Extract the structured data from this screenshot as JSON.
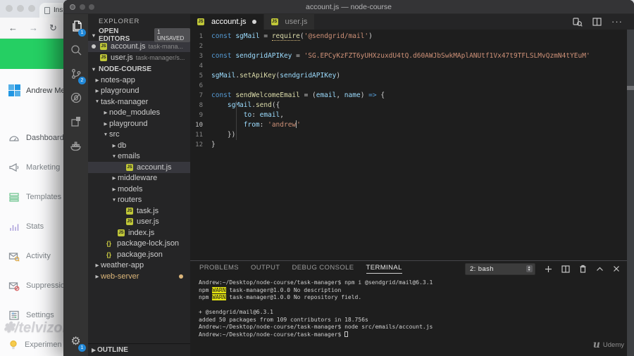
{
  "window": {
    "title": "account.js — node-course"
  },
  "browser": {
    "tab_label": "Ins",
    "banner_color": "#25cf63",
    "nav_icons": [
      "back-icon",
      "forward-icon",
      "reload-icon",
      "lock-icon"
    ],
    "sidebar": {
      "account_name": "Andrew Mead",
      "items": [
        {
          "label": "Dashboard",
          "icon": "gauge-icon"
        },
        {
          "label": "Marketing",
          "icon": "megaphone-icon"
        },
        {
          "label": "Templates",
          "icon": "templates-icon"
        },
        {
          "label": "Stats",
          "icon": "stats-icon"
        },
        {
          "label": "Activity",
          "icon": "activity-icon"
        },
        {
          "label": "Suppressions",
          "icon": "suppressions-icon"
        },
        {
          "label": "Settings",
          "icon": "settings-icon"
        },
        {
          "label": "Experimen",
          "icon": "bulb-icon"
        }
      ]
    },
    "watermark": "/telvizon"
  },
  "activity_bar": {
    "items": [
      {
        "icon": "files-icon",
        "badge": "1",
        "active": true
      },
      {
        "icon": "search-icon"
      },
      {
        "icon": "source-control-icon",
        "badge": "2"
      },
      {
        "icon": "debug-icon"
      },
      {
        "icon": "extensions-icon"
      },
      {
        "icon": "docker-icon"
      }
    ],
    "bottom": [
      {
        "icon": "gear-icon",
        "badge": "1"
      }
    ]
  },
  "explorer": {
    "title": "EXPLORER",
    "open_editors": {
      "label": "OPEN EDITORS",
      "badge": "1 UNSAVED",
      "files": [
        {
          "name": "account.js",
          "detail": "task-mana...",
          "modified": true,
          "selected": true
        },
        {
          "name": "user.js",
          "detail": "task-manager/s..."
        }
      ]
    },
    "section": "NODE-COURSE",
    "tree": [
      {
        "label": "notes-app",
        "type": "folder",
        "state": "collapsed",
        "indent": 0
      },
      {
        "label": "playground",
        "type": "folder",
        "state": "collapsed",
        "indent": 0
      },
      {
        "label": "task-manager",
        "type": "folder",
        "state": "expanded",
        "indent": 0
      },
      {
        "label": "node_modules",
        "type": "folder",
        "state": "collapsed",
        "indent": 1
      },
      {
        "label": "playground",
        "type": "folder",
        "state": "collapsed",
        "indent": 1
      },
      {
        "label": "src",
        "type": "folder",
        "state": "expanded",
        "indent": 1
      },
      {
        "label": "db",
        "type": "folder",
        "state": "collapsed",
        "indent": 2
      },
      {
        "label": "emails",
        "type": "folder",
        "state": "expanded",
        "indent": 2
      },
      {
        "label": "account.js",
        "type": "js",
        "indent": 3,
        "selected": true
      },
      {
        "label": "middleware",
        "type": "folder",
        "state": "collapsed",
        "indent": 2
      },
      {
        "label": "models",
        "type": "folder",
        "state": "collapsed",
        "indent": 2
      },
      {
        "label": "routers",
        "type": "folder",
        "state": "expanded",
        "indent": 2
      },
      {
        "label": "task.js",
        "type": "js",
        "indent": 3
      },
      {
        "label": "user.js",
        "type": "js",
        "indent": 3
      },
      {
        "label": "index.js",
        "type": "js",
        "indent": 2
      },
      {
        "label": "package-lock.json",
        "type": "json",
        "indent": 1
      },
      {
        "label": "package.json",
        "type": "json",
        "indent": 1
      },
      {
        "label": "weather-app",
        "type": "folder",
        "state": "collapsed",
        "indent": 0
      },
      {
        "label": "web-server",
        "type": "folder",
        "state": "collapsed",
        "indent": 0,
        "git_modified": true
      }
    ],
    "outline_label": "OUTLINE"
  },
  "editor": {
    "tabs": [
      {
        "label": "account.js",
        "active": true,
        "modified": true
      },
      {
        "label": "user.js"
      }
    ],
    "action_icons": [
      "open-changes-icon",
      "split-editor-icon",
      "more-actions-icon"
    ],
    "lines": [
      {
        "n": 1,
        "tokens": [
          {
            "t": "const ",
            "c": "kw"
          },
          {
            "t": "sgMail",
            "c": "var"
          },
          {
            "t": " = ",
            "c": "pln"
          },
          {
            "t": "require",
            "c": "fn u"
          },
          {
            "t": "(",
            "c": "pln"
          },
          {
            "t": "'@sendgrid/mail'",
            "c": "str"
          },
          {
            "t": ")",
            "c": "pln"
          }
        ]
      },
      {
        "n": 2,
        "tokens": []
      },
      {
        "n": 3,
        "tokens": [
          {
            "t": "const ",
            "c": "kw"
          },
          {
            "t": "sendgridAPIKey",
            "c": "var"
          },
          {
            "t": " = ",
            "c": "pln"
          },
          {
            "t": "'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'",
            "c": "str"
          }
        ]
      },
      {
        "n": 4,
        "tokens": []
      },
      {
        "n": 5,
        "tokens": [
          {
            "t": "sgMail",
            "c": "var"
          },
          {
            "t": ".",
            "c": "pln"
          },
          {
            "t": "setApiKey",
            "c": "fn"
          },
          {
            "t": "(",
            "c": "pln"
          },
          {
            "t": "sendgridAPIKey",
            "c": "var"
          },
          {
            "t": ")",
            "c": "pln"
          }
        ]
      },
      {
        "n": 6,
        "tokens": []
      },
      {
        "n": 7,
        "tokens": [
          {
            "t": "const ",
            "c": "kw"
          },
          {
            "t": "sendWelcomeEmail",
            "c": "fn"
          },
          {
            "t": " = (",
            "c": "pln"
          },
          {
            "t": "email",
            "c": "var"
          },
          {
            "t": ", ",
            "c": "pln"
          },
          {
            "t": "name",
            "c": "var"
          },
          {
            "t": ") ",
            "c": "pln"
          },
          {
            "t": "=>",
            "c": "kw"
          },
          {
            "t": " {",
            "c": "pln"
          }
        ]
      },
      {
        "n": 8,
        "tokens": [
          {
            "t": "    ",
            "c": "pln"
          },
          {
            "t": "sgMail",
            "c": "var"
          },
          {
            "t": ".",
            "c": "pln"
          },
          {
            "t": "send",
            "c": "fn"
          },
          {
            "t": "({",
            "c": "pln"
          }
        ]
      },
      {
        "n": 9,
        "tokens": [
          {
            "t": "        ",
            "c": "pln"
          },
          {
            "t": "to",
            "c": "var"
          },
          {
            "t": ": ",
            "c": "pln"
          },
          {
            "t": "email",
            "c": "var"
          },
          {
            "t": ",",
            "c": "pln"
          }
        ]
      },
      {
        "n": 10,
        "current": true,
        "tokens": [
          {
            "t": "        ",
            "c": "pln"
          },
          {
            "t": "from",
            "c": "var"
          },
          {
            "t": ": ",
            "c": "pln"
          },
          {
            "t": "'andrew",
            "c": "str"
          },
          {
            "t": "",
            "c": "caret"
          },
          {
            "t": "'",
            "c": "str"
          }
        ]
      },
      {
        "n": 11,
        "tokens": [
          {
            "t": "    ",
            "c": "pln"
          },
          {
            "t": "})",
            "c": "pln"
          }
        ]
      },
      {
        "n": 12,
        "tokens": [
          {
            "t": "}",
            "c": "pln"
          }
        ]
      }
    ]
  },
  "panel": {
    "tabs": [
      "PROBLEMS",
      "OUTPUT",
      "DEBUG CONSOLE",
      "TERMINAL"
    ],
    "active_tab": "TERMINAL",
    "shell_select": "2: bash",
    "action_icons": [
      "new-terminal-icon",
      "split-terminal-icon",
      "kill-terminal-icon",
      "maximize-panel-icon",
      "close-panel-icon"
    ],
    "terminal_lines": [
      [
        {
          "t": "Andrew:~/Desktop/node-course/task-manager$ npm i @sendgrid/mail@6.3.1"
        }
      ],
      [
        {
          "t": "npm "
        },
        {
          "t": "WARN",
          "warn": true
        },
        {
          "t": " task-manager@1.0.0 No description"
        }
      ],
      [
        {
          "t": "npm "
        },
        {
          "t": "WARN",
          "warn": true
        },
        {
          "t": " task-manager@1.0.0 No repository field."
        }
      ],
      [],
      [
        {
          "t": "+ @sendgrid/mail@6.3.1"
        }
      ],
      [
        {
          "t": "added 50 packages from 109 contributors in 18.756s"
        }
      ],
      [
        {
          "t": "Andrew:~/Desktop/node-course/task-manager$ node src/emails/account.js"
        }
      ],
      [
        {
          "t": "Andrew:~/Desktop/node-course/task-manager$ "
        },
        {
          "t": "",
          "cursor": true
        }
      ]
    ]
  },
  "watermarks": {
    "udemy": "Udemy"
  },
  "colors": {
    "badge_blue": "#2188d8",
    "warn_yellow": "#e5e510",
    "git_modified": "#dcb67a",
    "banner_green": "#25cf63"
  }
}
